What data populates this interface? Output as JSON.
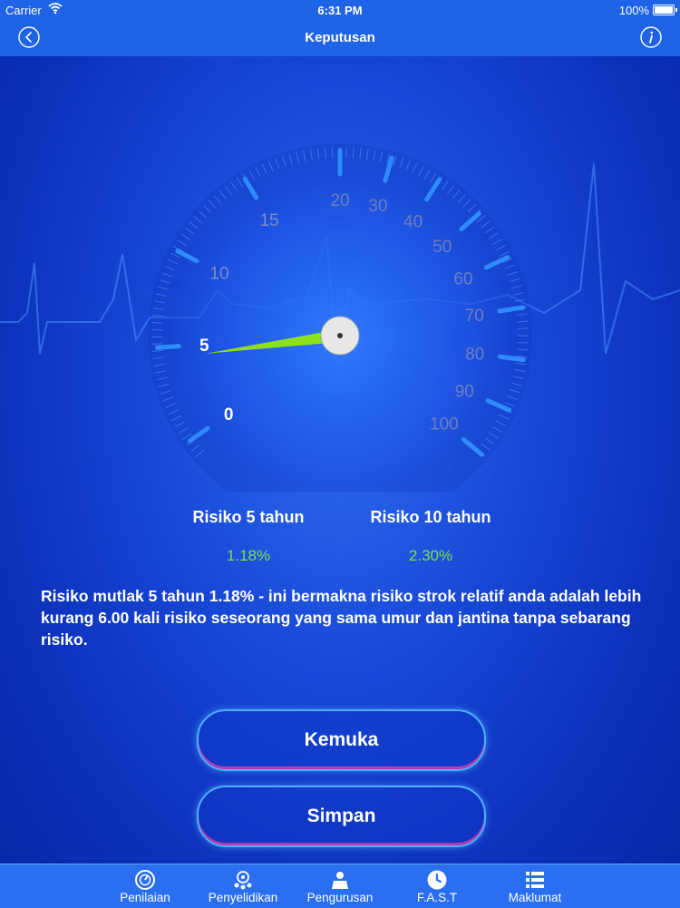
{
  "status": {
    "carrier": "Carrier",
    "time": "6:31 PM",
    "battery": "100%"
  },
  "nav": {
    "title": "Keputusan",
    "back_icon": "back-chevron-icon",
    "info_icon": "info-icon"
  },
  "gauge": {
    "inner_ticks": [
      "0",
      "5",
      "10",
      "15"
    ],
    "outer_ticks": [
      "20",
      "30",
      "40",
      "50",
      "60",
      "70",
      "80",
      "90",
      "100"
    ],
    "needle_value": 1.18,
    "needle_color": "#8ee01a",
    "accent": "#2f8cff"
  },
  "risk": {
    "five_year_label": "Risiko 5 tahun",
    "five_year_value": "1.18%",
    "ten_year_label": "Risiko 10 tahun",
    "ten_year_value": "2.30%",
    "value_color": "#7ee04e"
  },
  "description": "Risiko mutlak 5 tahun  1.18% - ini bermakna risiko strok relatif anda adalah lebih kurang 6.00 kali risiko seseorang yang sama umur dan jantina tanpa sebarang risiko.",
  "buttons": {
    "primary": "Kemuka",
    "secondary": "Simpan"
  },
  "tabs": [
    {
      "label": "Penilaian",
      "icon": "gauge-icon"
    },
    {
      "label": "Penyelidikan",
      "icon": "research-icon"
    },
    {
      "label": "Pengurusan",
      "icon": "management-icon"
    },
    {
      "label": "F.A.S.T",
      "icon": "clock-icon"
    },
    {
      "label": "Maklumat",
      "icon": "list-icon"
    }
  ]
}
